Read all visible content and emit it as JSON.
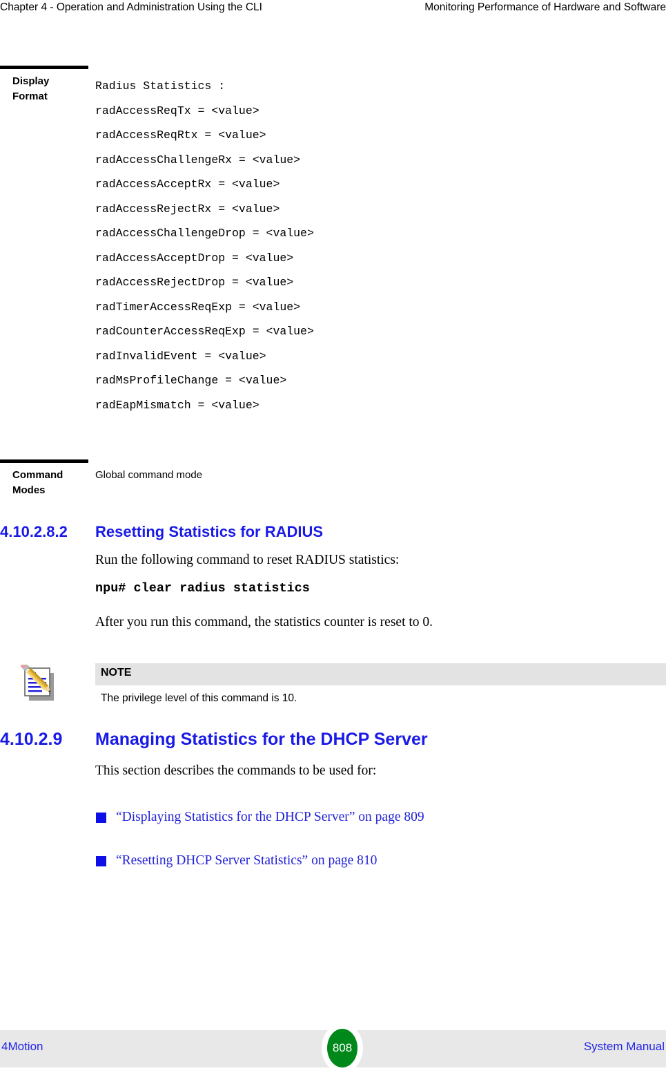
{
  "header": {
    "left": "Chapter 4 - Operation and Administration Using the CLI",
    "right": "Monitoring Performance of Hardware and Software"
  },
  "spec_table": {
    "display_format": {
      "label_line1": "Display",
      "label_line2": "Format",
      "lines": [
        "Radius Statistics :",
        "radAccessReqTx = <value>",
        "radAccessReqRtx = <value>",
        "radAccessChallengeRx = <value>",
        "radAccessAcceptRx = <value>",
        "radAccessRejectRx = <value>",
        "radAccessChallengeDrop = <value>",
        "radAccessAcceptDrop = <value>",
        "radAccessRejectDrop = <value>",
        "radTimerAccessReqExp = <value>",
        "radCounterAccessReqExp = <value>",
        "radInvalidEvent = <value>",
        "radMsProfileChange = <value>",
        "radEapMismatch = <value>"
      ]
    },
    "command_modes": {
      "label_line1": "Command",
      "label_line2": "Modes",
      "value": "Global command mode"
    }
  },
  "section_reset": {
    "number": "4.10.2.8.2",
    "title": "Resetting Statistics for RADIUS",
    "intro": "Run the following command to reset RADIUS statistics:",
    "command": "npu# clear radius statistics",
    "after": "After you run this command, the statistics counter is reset to 0."
  },
  "note": {
    "icon": "note-pencil-icon",
    "label": "NOTE",
    "text": "The privilege level of this command is 10."
  },
  "section_dhcp": {
    "number": "4.10.2.9",
    "title": "Managing Statistics for the DHCP Server",
    "intro": "This section describes the commands to be used for:",
    "links": [
      "“Displaying Statistics for the DHCP Server” on page 809",
      "“Resetting DHCP Server Statistics” on page 810"
    ]
  },
  "footer": {
    "left": "4Motion",
    "page": "808",
    "right": "System Manual"
  },
  "colors": {
    "heading_blue": "#1A1AE8",
    "link_blue": "#2222D8",
    "footer_blue": "#2222EE",
    "page_circle_green": "#00891A",
    "note_bar_gray": "#E3E3E3",
    "footer_band_gray": "#E8E8E8"
  }
}
